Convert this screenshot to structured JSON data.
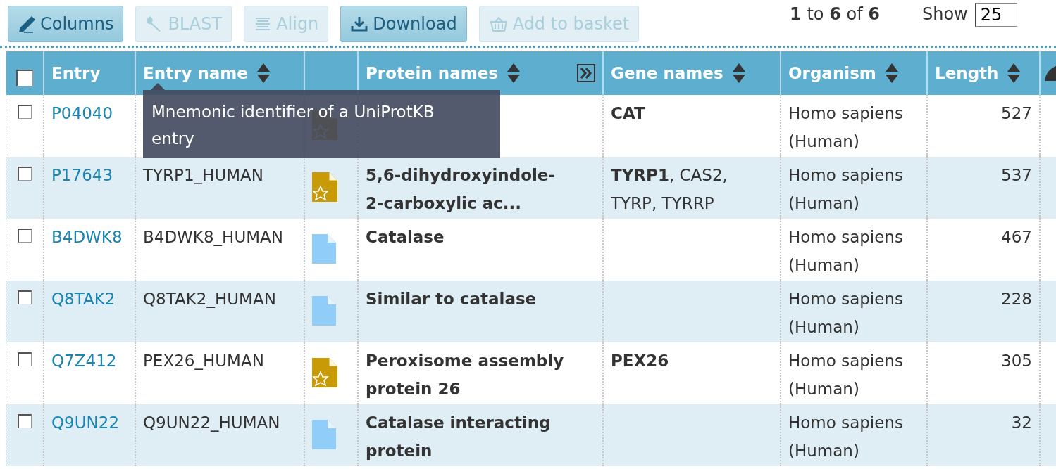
{
  "toolbar": {
    "buttons": [
      {
        "kind": "columns",
        "label": "Columns",
        "disabled": false
      },
      {
        "kind": "blast",
        "label": "BLAST",
        "disabled": true
      },
      {
        "kind": "align",
        "label": "Align",
        "disabled": true
      },
      {
        "kind": "download",
        "label": "Download",
        "disabled": false
      },
      {
        "kind": "basket",
        "label": "Add to basket",
        "disabled": true
      }
    ],
    "pagination": "**1** to **6** of **6**",
    "show_label": "Show",
    "show_value": "25"
  },
  "table": {
    "select_all": {
      "checked": false
    },
    "columns": [
      {
        "label": "Entry",
        "sortable": false
      },
      {
        "label": "Entry name",
        "sortable": true
      },
      {
        "sortable": false
      },
      {
        "label": "Protein names",
        "sortable": true
      },
      {
        "label": "Gene names",
        "sortable": true
      },
      {
        "label": "Organism",
        "sortable": true
      },
      {
        "label": "Length",
        "sortable": true
      }
    ],
    "rows": [
      {
        "checked": false,
        "entry": "P04040",
        "kind": "reviewed",
        "genes": "**CAT**",
        "organism": "Homo sapiens (Human)",
        "length": "527"
      },
      {
        "checked": false,
        "entry": "P17643",
        "entry_name": "TYRP1_HUMAN",
        "kind": "reviewed",
        "protein": "5,6-dihydroxyindole-2-carboxylic ac...",
        "genes": "**TYRP1**, CAS2, TYRP, TYRRP",
        "organism": "Homo sapiens (Human)",
        "length": "537"
      },
      {
        "checked": false,
        "entry": "B4DWK8",
        "entry_name": "B4DWK8_HUMAN",
        "kind": "unreviewed",
        "protein": "Catalase",
        "organism": "Homo sapiens (Human)",
        "length": "467"
      },
      {
        "checked": false,
        "entry": "Q8TAK2",
        "entry_name": "Q8TAK2_HUMAN",
        "kind": "unreviewed",
        "protein": "Similar to catalase",
        "organism": "Homo sapiens (Human)",
        "length": "228"
      },
      {
        "checked": false,
        "entry": "Q7Z412",
        "entry_name": "PEX26_HUMAN",
        "kind": "reviewed",
        "protein": "Peroxisome assembly protein 26",
        "genes": "**PEX26**",
        "organism": "Homo sapiens (Human)",
        "length": "305"
      },
      {
        "checked": false,
        "entry": "Q9UN22",
        "entry_name": "Q9UN22_HUMAN",
        "kind": "unreviewed",
        "protein": "Catalase interacting protein",
        "organism": "Homo sapiens (Human)",
        "length": "32"
      }
    ],
    "tooltip": "Mnemonic identifier of a UniProtKB entry"
  }
}
